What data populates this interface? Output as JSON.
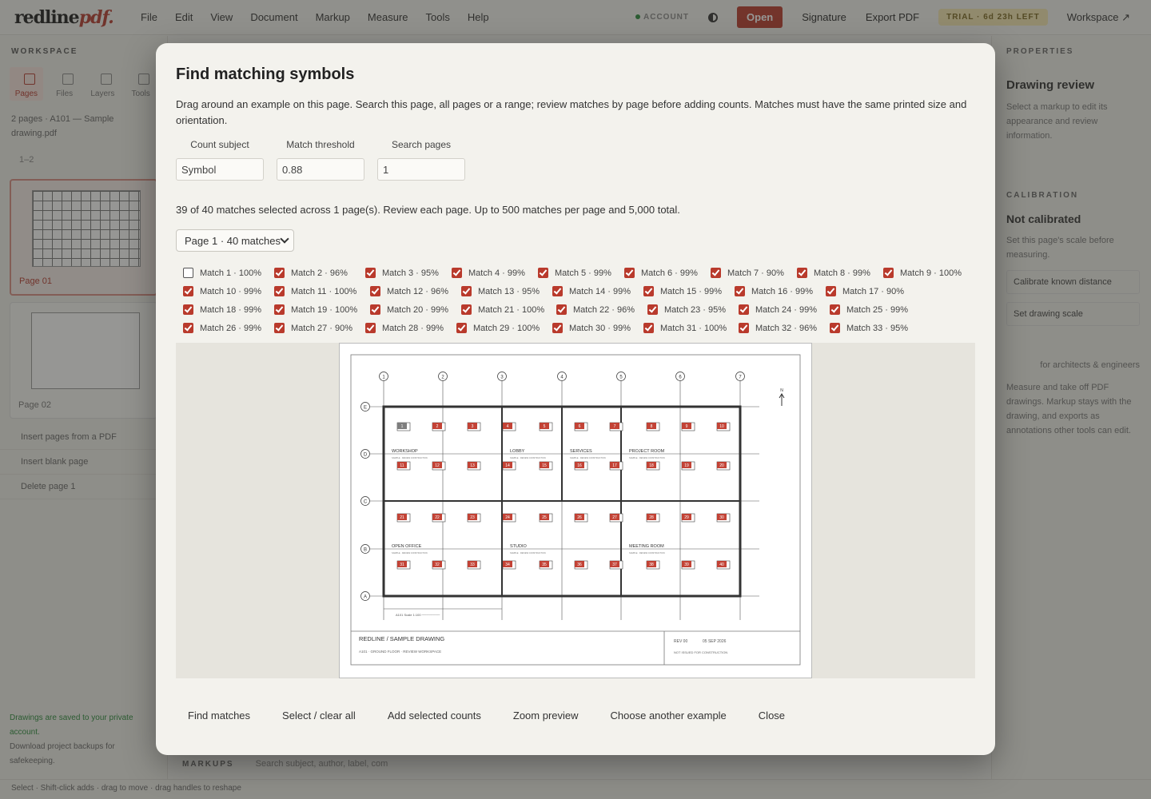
{
  "app": {
    "logo_main": "redline",
    "logo_accent": "pdf.",
    "menu": [
      "File",
      "Edit",
      "View",
      "Document",
      "Markup",
      "Measure",
      "Tools",
      "Help"
    ],
    "account": "ACCOUNT",
    "open": "Open",
    "signature": "Signature",
    "export": "Export PDF",
    "trial": "TRIAL · 6d 23h LEFT",
    "workspace": "Workspace ↗"
  },
  "left_panel": {
    "heading": "WORKSPACE",
    "tabs": [
      "Pages",
      "Files",
      "Layers",
      "Tools"
    ],
    "info": "2 pages · A101 — Sample drawing.pdf",
    "zoom": "1–2",
    "page1": "Page 01",
    "page2": "Page 02",
    "links": [
      "Insert pages from a PDF",
      "Insert blank page",
      "Delete page 1"
    ],
    "footer_line1": "Drawings are saved to your private account.",
    "footer_line2": "Download project backups for safekeeping."
  },
  "right_panel": {
    "heading": "PROPERTIES",
    "title": "Drawing review",
    "text": "Select a markup to edit its appearance and review information.",
    "sec": "CALIBRATION",
    "calib": "Not calibrated",
    "calib_text": "Set this page's scale before measuring.",
    "btn1": "Calibrate known distance",
    "btn2": "Set drawing scale",
    "tag": "for architects & engineers",
    "about": "Measure and take off PDF drawings. Markup stays with the drawing, and exports as annotations other tools can edit."
  },
  "bottom": {
    "status": "Select · Shift-click adds · drag to move · drag handles to reshape",
    "markups": "MARKUPS",
    "search_placeholder": "Search subject, author, label, com"
  },
  "dialog": {
    "title": "Find matching symbols",
    "description": "Drag around an example on this page. Search this page, all pages or a range; review matches by page before adding counts. Matches must have the same printed size and orientation.",
    "fields": [
      {
        "label": "Count subject",
        "value": "Symbol"
      },
      {
        "label": "Match threshold",
        "value": "0.88"
      },
      {
        "label": "Search pages",
        "value": "1"
      }
    ],
    "summary": "39 of 40 matches selected across 1 page(s). Review each page. Up to 500 matches per page and 5,000 total.",
    "page_select": "Page 1 · 40 matches",
    "matches": [
      {
        "label": "Match 1 · 100%",
        "checked": false
      },
      {
        "label": "Match 2 · 96%",
        "checked": true
      },
      {
        "label": "Match 3 · 95%",
        "checked": true
      },
      {
        "label": "Match 4 · 99%",
        "checked": true
      },
      {
        "label": "Match 5 · 99%",
        "checked": true
      },
      {
        "label": "Match 6 · 99%",
        "checked": true
      },
      {
        "label": "Match 7 · 90%",
        "checked": true
      },
      {
        "label": "Match 8 · 99%",
        "checked": true
      },
      {
        "label": "Match 9 · 100%",
        "checked": true
      },
      {
        "label": "Match 10 · 99%",
        "checked": true
      },
      {
        "label": "Match 11 · 100%",
        "checked": true
      },
      {
        "label": "Match 12 · 96%",
        "checked": true
      },
      {
        "label": "Match 13 · 95%",
        "checked": true
      },
      {
        "label": "Match 14 · 99%",
        "checked": true
      },
      {
        "label": "Match 15 · 99%",
        "checked": true
      },
      {
        "label": "Match 16 · 99%",
        "checked": true
      },
      {
        "label": "Match 17 · 90%",
        "checked": true
      },
      {
        "label": "Match 18 · 99%",
        "checked": true
      },
      {
        "label": "Match 19 · 100%",
        "checked": true
      },
      {
        "label": "Match 20 · 99%",
        "checked": true
      },
      {
        "label": "Match 21 · 100%",
        "checked": true
      },
      {
        "label": "Match 22 · 96%",
        "checked": true
      },
      {
        "label": "Match 23 · 95%",
        "checked": true
      },
      {
        "label": "Match 24 · 99%",
        "checked": true
      },
      {
        "label": "Match 25 · 99%",
        "checked": true
      },
      {
        "label": "Match 26 · 99%",
        "checked": true
      },
      {
        "label": "Match 27 · 90%",
        "checked": true
      },
      {
        "label": "Match 28 · 99%",
        "checked": true
      },
      {
        "label": "Match 29 · 100%",
        "checked": true
      },
      {
        "label": "Match 30 · 99%",
        "checked": true
      },
      {
        "label": "Match 31 · 100%",
        "checked": true
      },
      {
        "label": "Match 32 · 96%",
        "checked": true
      },
      {
        "label": "Match 33 · 95%",
        "checked": true
      }
    ],
    "drawing": {
      "grid_cols": [
        "1",
        "2",
        "3",
        "4",
        "5",
        "6",
        "7"
      ],
      "grid_rows": [
        "E",
        "D",
        "C",
        "B",
        "A"
      ],
      "north": "N",
      "rooms": [
        "WORKSHOP",
        "LOBBY",
        "SERVICES",
        "PROJECT ROOM",
        "OPEN OFFICE",
        "STUDIO",
        "MEETING ROOM"
      ],
      "room_note": "SAMPLE · REVIEW CONSTRUCTION",
      "scale_note": "A101 Scale 1:100 ────────",
      "title_block": "REDLINE  /  SAMPLE DRAWING",
      "sheet_name": "A101 · GROUND FLOOR · REVIEW WORKSPACE",
      "rev": "REV 00",
      "date": "05 SEP 2026",
      "status": "NOT ISSUED FOR CONSTRUCTION"
    },
    "actions": [
      "Find matches",
      "Select / clear all",
      "Add selected counts",
      "Zoom preview",
      "Choose another example",
      "Close"
    ]
  },
  "colors": {
    "accent": "#b93a2c",
    "trial_bg": "#f4e7b0"
  }
}
